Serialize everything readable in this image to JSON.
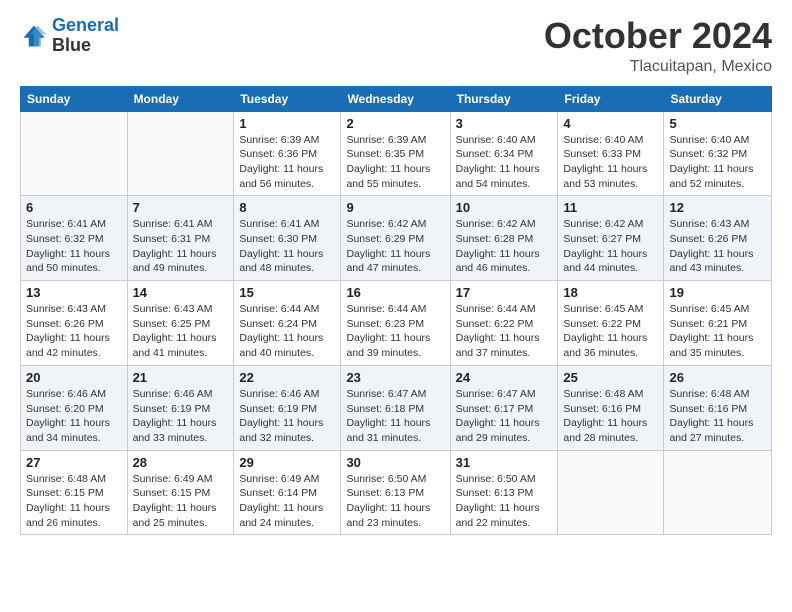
{
  "header": {
    "logo_line1": "General",
    "logo_line2": "Blue",
    "month": "October 2024",
    "location": "Tlacuitapan, Mexico"
  },
  "weekdays": [
    "Sunday",
    "Monday",
    "Tuesday",
    "Wednesday",
    "Thursday",
    "Friday",
    "Saturday"
  ],
  "weeks": [
    [
      {
        "day": "",
        "sunrise": "",
        "sunset": "",
        "daylight": ""
      },
      {
        "day": "",
        "sunrise": "",
        "sunset": "",
        "daylight": ""
      },
      {
        "day": "1",
        "sunrise": "Sunrise: 6:39 AM",
        "sunset": "Sunset: 6:36 PM",
        "daylight": "Daylight: 11 hours and 56 minutes."
      },
      {
        "day": "2",
        "sunrise": "Sunrise: 6:39 AM",
        "sunset": "Sunset: 6:35 PM",
        "daylight": "Daylight: 11 hours and 55 minutes."
      },
      {
        "day": "3",
        "sunrise": "Sunrise: 6:40 AM",
        "sunset": "Sunset: 6:34 PM",
        "daylight": "Daylight: 11 hours and 54 minutes."
      },
      {
        "day": "4",
        "sunrise": "Sunrise: 6:40 AM",
        "sunset": "Sunset: 6:33 PM",
        "daylight": "Daylight: 11 hours and 53 minutes."
      },
      {
        "day": "5",
        "sunrise": "Sunrise: 6:40 AM",
        "sunset": "Sunset: 6:32 PM",
        "daylight": "Daylight: 11 hours and 52 minutes."
      }
    ],
    [
      {
        "day": "6",
        "sunrise": "Sunrise: 6:41 AM",
        "sunset": "Sunset: 6:32 PM",
        "daylight": "Daylight: 11 hours and 50 minutes."
      },
      {
        "day": "7",
        "sunrise": "Sunrise: 6:41 AM",
        "sunset": "Sunset: 6:31 PM",
        "daylight": "Daylight: 11 hours and 49 minutes."
      },
      {
        "day": "8",
        "sunrise": "Sunrise: 6:41 AM",
        "sunset": "Sunset: 6:30 PM",
        "daylight": "Daylight: 11 hours and 48 minutes."
      },
      {
        "day": "9",
        "sunrise": "Sunrise: 6:42 AM",
        "sunset": "Sunset: 6:29 PM",
        "daylight": "Daylight: 11 hours and 47 minutes."
      },
      {
        "day": "10",
        "sunrise": "Sunrise: 6:42 AM",
        "sunset": "Sunset: 6:28 PM",
        "daylight": "Daylight: 11 hours and 46 minutes."
      },
      {
        "day": "11",
        "sunrise": "Sunrise: 6:42 AM",
        "sunset": "Sunset: 6:27 PM",
        "daylight": "Daylight: 11 hours and 44 minutes."
      },
      {
        "day": "12",
        "sunrise": "Sunrise: 6:43 AM",
        "sunset": "Sunset: 6:26 PM",
        "daylight": "Daylight: 11 hours and 43 minutes."
      }
    ],
    [
      {
        "day": "13",
        "sunrise": "Sunrise: 6:43 AM",
        "sunset": "Sunset: 6:26 PM",
        "daylight": "Daylight: 11 hours and 42 minutes."
      },
      {
        "day": "14",
        "sunrise": "Sunrise: 6:43 AM",
        "sunset": "Sunset: 6:25 PM",
        "daylight": "Daylight: 11 hours and 41 minutes."
      },
      {
        "day": "15",
        "sunrise": "Sunrise: 6:44 AM",
        "sunset": "Sunset: 6:24 PM",
        "daylight": "Daylight: 11 hours and 40 minutes."
      },
      {
        "day": "16",
        "sunrise": "Sunrise: 6:44 AM",
        "sunset": "Sunset: 6:23 PM",
        "daylight": "Daylight: 11 hours and 39 minutes."
      },
      {
        "day": "17",
        "sunrise": "Sunrise: 6:44 AM",
        "sunset": "Sunset: 6:22 PM",
        "daylight": "Daylight: 11 hours and 37 minutes."
      },
      {
        "day": "18",
        "sunrise": "Sunrise: 6:45 AM",
        "sunset": "Sunset: 6:22 PM",
        "daylight": "Daylight: 11 hours and 36 minutes."
      },
      {
        "day": "19",
        "sunrise": "Sunrise: 6:45 AM",
        "sunset": "Sunset: 6:21 PM",
        "daylight": "Daylight: 11 hours and 35 minutes."
      }
    ],
    [
      {
        "day": "20",
        "sunrise": "Sunrise: 6:46 AM",
        "sunset": "Sunset: 6:20 PM",
        "daylight": "Daylight: 11 hours and 34 minutes."
      },
      {
        "day": "21",
        "sunrise": "Sunrise: 6:46 AM",
        "sunset": "Sunset: 6:19 PM",
        "daylight": "Daylight: 11 hours and 33 minutes."
      },
      {
        "day": "22",
        "sunrise": "Sunrise: 6:46 AM",
        "sunset": "Sunset: 6:19 PM",
        "daylight": "Daylight: 11 hours and 32 minutes."
      },
      {
        "day": "23",
        "sunrise": "Sunrise: 6:47 AM",
        "sunset": "Sunset: 6:18 PM",
        "daylight": "Daylight: 11 hours and 31 minutes."
      },
      {
        "day": "24",
        "sunrise": "Sunrise: 6:47 AM",
        "sunset": "Sunset: 6:17 PM",
        "daylight": "Daylight: 11 hours and 29 minutes."
      },
      {
        "day": "25",
        "sunrise": "Sunrise: 6:48 AM",
        "sunset": "Sunset: 6:16 PM",
        "daylight": "Daylight: 11 hours and 28 minutes."
      },
      {
        "day": "26",
        "sunrise": "Sunrise: 6:48 AM",
        "sunset": "Sunset: 6:16 PM",
        "daylight": "Daylight: 11 hours and 27 minutes."
      }
    ],
    [
      {
        "day": "27",
        "sunrise": "Sunrise: 6:48 AM",
        "sunset": "Sunset: 6:15 PM",
        "daylight": "Daylight: 11 hours and 26 minutes."
      },
      {
        "day": "28",
        "sunrise": "Sunrise: 6:49 AM",
        "sunset": "Sunset: 6:15 PM",
        "daylight": "Daylight: 11 hours and 25 minutes."
      },
      {
        "day": "29",
        "sunrise": "Sunrise: 6:49 AM",
        "sunset": "Sunset: 6:14 PM",
        "daylight": "Daylight: 11 hours and 24 minutes."
      },
      {
        "day": "30",
        "sunrise": "Sunrise: 6:50 AM",
        "sunset": "Sunset: 6:13 PM",
        "daylight": "Daylight: 11 hours and 23 minutes."
      },
      {
        "day": "31",
        "sunrise": "Sunrise: 6:50 AM",
        "sunset": "Sunset: 6:13 PM",
        "daylight": "Daylight: 11 hours and 22 minutes."
      },
      {
        "day": "",
        "sunrise": "",
        "sunset": "",
        "daylight": ""
      },
      {
        "day": "",
        "sunrise": "",
        "sunset": "",
        "daylight": ""
      }
    ]
  ]
}
